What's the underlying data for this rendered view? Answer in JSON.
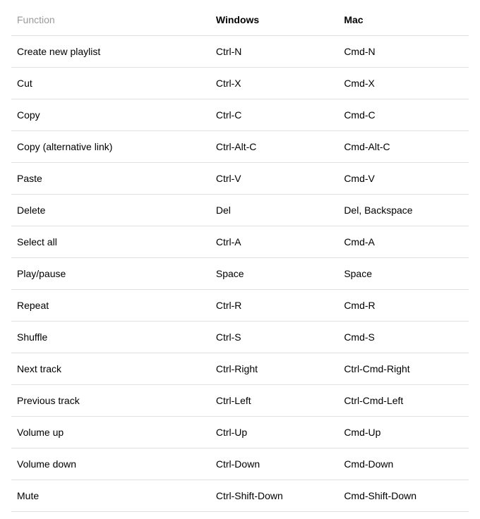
{
  "headers": {
    "function": "Function",
    "windows": "Windows",
    "mac": "Mac"
  },
  "rows": [
    {
      "function": "Create new playlist",
      "windows": "Ctrl-N",
      "mac": "Cmd-N"
    },
    {
      "function": "Cut",
      "windows": "Ctrl-X",
      "mac": "Cmd-X"
    },
    {
      "function": "Copy",
      "windows": "Ctrl-C",
      "mac": "Cmd-C"
    },
    {
      "function": "Copy (alternative link)",
      "windows": "Ctrl-Alt-C",
      "mac": "Cmd-Alt-C"
    },
    {
      "function": "Paste",
      "windows": "Ctrl-V",
      "mac": "Cmd-V"
    },
    {
      "function": "Delete",
      "windows": "Del",
      "mac": "Del, Backspace"
    },
    {
      "function": "Select all",
      "windows": "Ctrl-A",
      "mac": "Cmd-A"
    },
    {
      "function": "Play/pause",
      "windows": "Space",
      "mac": "Space"
    },
    {
      "function": "Repeat",
      "windows": "Ctrl-R",
      "mac": "Cmd-R"
    },
    {
      "function": "Shuffle",
      "windows": "Ctrl-S",
      "mac": "Cmd-S"
    },
    {
      "function": "Next track",
      "windows": "Ctrl-Right",
      "mac": "Ctrl-Cmd-Right"
    },
    {
      "function": "Previous track",
      "windows": "Ctrl-Left",
      "mac": "Ctrl-Cmd-Left"
    },
    {
      "function": "Volume up",
      "windows": "Ctrl-Up",
      "mac": "Cmd-Up"
    },
    {
      "function": "Volume down",
      "windows": "Ctrl-Down",
      "mac": "Cmd-Down"
    },
    {
      "function": "Mute",
      "windows": "Ctrl-Shift-Down",
      "mac": "Cmd-Shift-Down"
    }
  ]
}
